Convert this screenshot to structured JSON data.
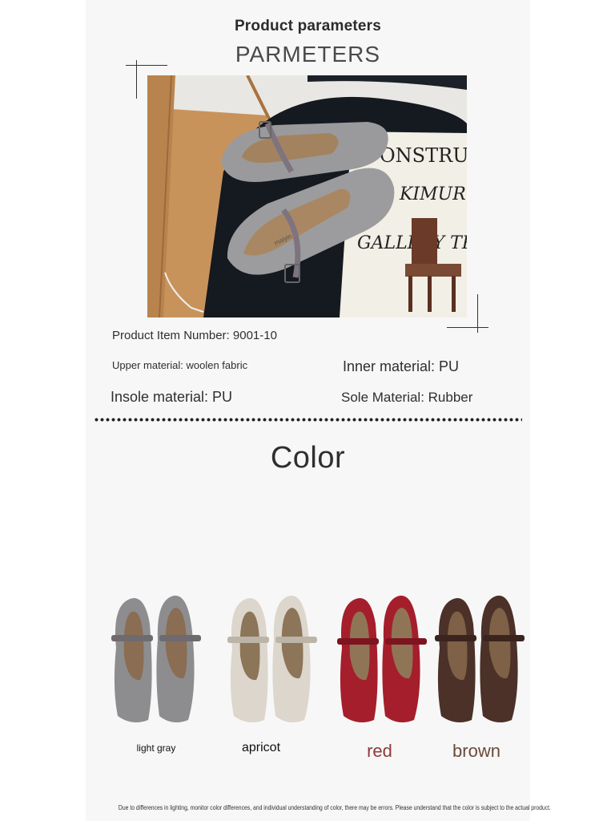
{
  "header": {
    "title": "Product parameters",
    "subtitle": "PARMETERS"
  },
  "params": {
    "item_number": "Product Item Number: 9001-10",
    "upper_material": "Upper material: woolen fabric",
    "inner_material": "Inner material: PU",
    "insole_material": "Insole material: PU",
    "sole_material": "Sole Material: Rubber"
  },
  "photo": {
    "book_text_1": "ONSTRUCT",
    "book_text_2": "KIMUR",
    "book_text_3": "GALLERY TR",
    "shoe_tag": "maiyin"
  },
  "color_section": {
    "title": "Color",
    "options": [
      {
        "label": "light gray",
        "body": "#8d8d8f",
        "trim": "#6e6a70",
        "inner": "#8a6d52"
      },
      {
        "label": "apricot",
        "body": "#ddd6cc",
        "trim": "#bdb4a8",
        "inner": "#8c7558"
      },
      {
        "label": "red",
        "body": "#a51e2c",
        "trim": "#7d1420",
        "inner": "#8f7556"
      },
      {
        "label": "brown",
        "body": "#4b3128",
        "trim": "#3a241d",
        "inner": "#7e6146"
      }
    ]
  },
  "disclaimer": "Due to differences in lighting, monitor color differences, and individual understanding of color, there may be errors. Please understand that the color is subject to the actual product."
}
